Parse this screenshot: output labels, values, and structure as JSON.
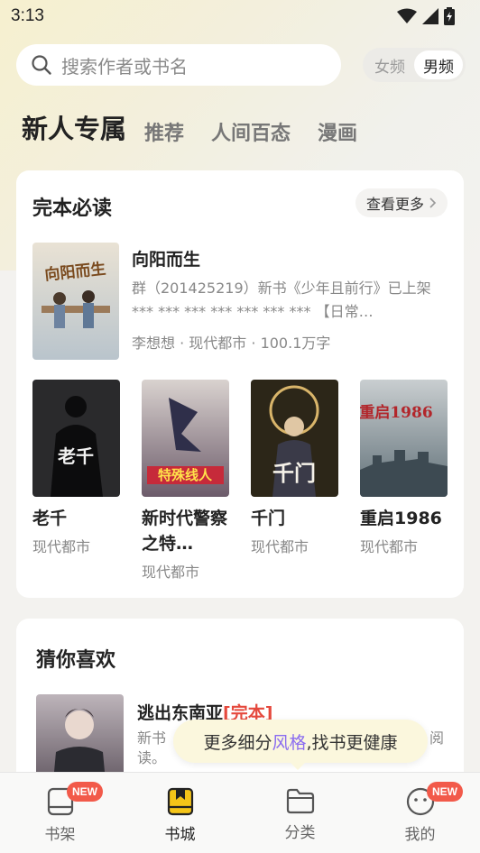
{
  "status": {
    "time": "3:13"
  },
  "search": {
    "placeholder": "搜索作者或书名"
  },
  "gender": {
    "female": "女频",
    "male": "男频"
  },
  "tabs": [
    {
      "label": "新人专属",
      "active": true
    },
    {
      "label": "推荐"
    },
    {
      "label": "人间百态"
    },
    {
      "label": "漫画"
    }
  ],
  "section_complete": {
    "title": "完本必读",
    "more": "查看更多",
    "featured": {
      "title": "向阳而生",
      "cover_text": "向阳而生",
      "description": "群（201425219）新书《少年且前行》已上架 *** *** *** *** *** *** *** 【日常…",
      "author": "李想想",
      "category": "现代都市",
      "words": "100.1万字"
    },
    "books": [
      {
        "title": "老千",
        "category": "现代都市",
        "cover_text": "老千"
      },
      {
        "title": "新时代警察之特…",
        "category": "现代都市",
        "cover_text": "特殊线人"
      },
      {
        "title": "千门",
        "category": "现代都市",
        "cover_text": "千门"
      },
      {
        "title": "重启1986",
        "category": "现代都市",
        "cover_text": "重启1986"
      }
    ]
  },
  "section_guess": {
    "title": "猜你喜欢",
    "item": {
      "title": "逃出东南亚",
      "tag": "[完本]",
      "desc_line1": "新书",
      "desc_line2": "读。",
      "desc_tail": "阅"
    }
  },
  "tooltip": {
    "pre": "更多细分",
    "highlight": "风格",
    "post": ",找书更健康"
  },
  "nav": [
    {
      "label": "书架",
      "badge": "NEW"
    },
    {
      "label": "书城",
      "active": true
    },
    {
      "label": "分类"
    },
    {
      "label": "我的",
      "badge": "NEW"
    }
  ],
  "colors": {
    "accent": "#f5c518",
    "badge": "#f25a4a",
    "highlight": "#8a6cf0"
  }
}
